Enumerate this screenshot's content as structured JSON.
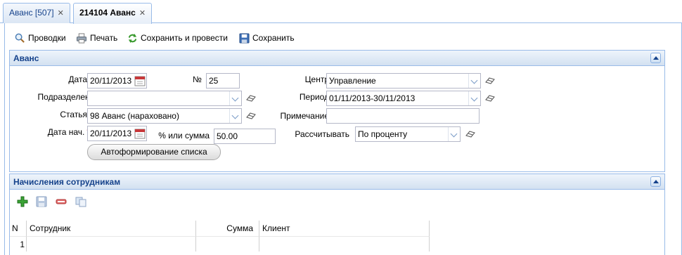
{
  "tabs": [
    {
      "label": "Аванс [507]"
    },
    {
      "label": "214104 Аванс"
    }
  ],
  "toolbar": {
    "entries_label": "Проводки",
    "print_label": "Печать",
    "save_post_label": "Сохранить и провести",
    "save_label": "Сохранить"
  },
  "form_panel": {
    "title": "Аванс",
    "date_label": "Дата",
    "date_value": "20/11/2013",
    "number_label": "№",
    "number_value": "25",
    "center_label": "Центр",
    "center_value": "Управление",
    "division_label": "Подразделение",
    "division_value": "",
    "period_label": "Период",
    "period_value": "01/11/2013-30/11/2013",
    "article_label": "Статья",
    "article_value": "98 Аванс (нараховано)",
    "note_label": "Примечание",
    "note_value": "",
    "start_date_label": "Дата нач.",
    "start_date_required": "*",
    "start_date_value": "20/11/2013",
    "percent_label": "% или сумма",
    "percent_value": "50.00",
    "calc_label": "Рассчитывать",
    "calc_value": "По проценту",
    "autoform_label": "Автоформирование списка"
  },
  "grid_panel": {
    "title": "Начисления сотрудникам",
    "columns": [
      "N",
      "Сотрудник",
      "Сумма",
      "Клиент"
    ],
    "rows": [
      {
        "n": "1",
        "employee": "",
        "sum": "",
        "client": ""
      }
    ]
  },
  "colors": {
    "panel_border": "#99bbe8",
    "header_text": "#15428b",
    "required": "#cc0000"
  },
  "icons": [
    "magnifier-icon",
    "printer-icon",
    "refresh-icon",
    "floppy-icon",
    "calendar-icon",
    "eraser-icon",
    "add-icon",
    "delete-icon",
    "copy-icon"
  ]
}
